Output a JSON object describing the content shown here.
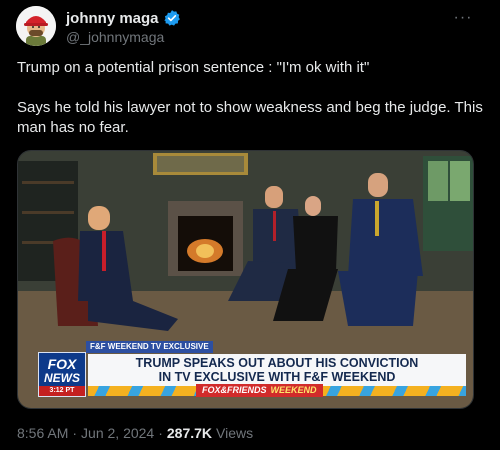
{
  "author": {
    "display_name": "johnny maga",
    "handle": "@_johnnymaga",
    "verified": true,
    "avatar_icon": "cartoon-avatar-red-cap"
  },
  "more_icon": "more-horizontal-icon",
  "post": {
    "lines": [
      "Trump on a potential prison sentence : \"I'm ok with it\"",
      "Says he told his lawyer not to show weakness and beg the judge. This man has no fear."
    ]
  },
  "media": {
    "description_icon": "video-still",
    "chyron": {
      "tag": "F&F WEEKEND TV EXCLUSIVE",
      "headline_1": "TRUMP SPEAKS OUT ABOUT HIS CONVICTION",
      "headline_2": "IN TV EXCLUSIVE WITH F&F WEEKEND",
      "brand": "FOX&FRIENDS",
      "brand_suffix": "WEEKEND",
      "logo_line1": "FOX",
      "logo_line2": "NEWS",
      "time": "3:12 PT"
    }
  },
  "meta": {
    "time": "8:56 AM",
    "sep1": "·",
    "date": "Jun 2, 2024",
    "sep2": "·",
    "views": "287.7K",
    "views_label": "Views"
  },
  "colors": {
    "background": "#000000",
    "text": "#e7e9ea",
    "secondary": "#71767b",
    "verified": "#1d9bf0"
  }
}
